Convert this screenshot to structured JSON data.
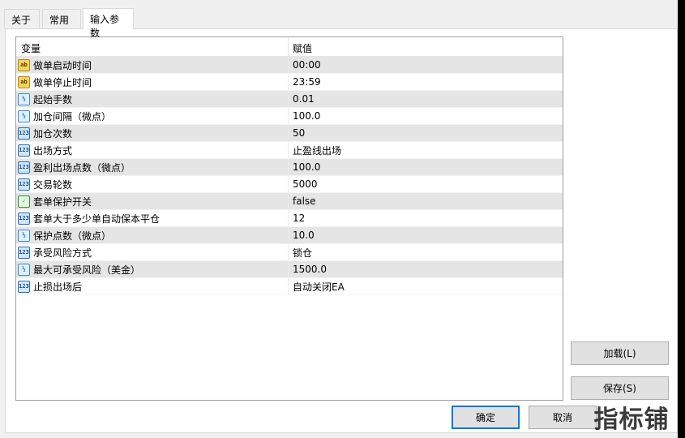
{
  "tabs": [
    {
      "label": "关于"
    },
    {
      "label": "常用"
    },
    {
      "label": "输入参数",
      "active": true
    }
  ],
  "grid": {
    "headers": {
      "variable": "变量",
      "value": "赋值"
    },
    "rows": [
      {
        "icon": "ab",
        "name": "做单启动时间",
        "value": "00:00"
      },
      {
        "icon": "ab",
        "name": "做单停止时间",
        "value": "23:59"
      },
      {
        "icon": "v2",
        "name": "起始手数",
        "value": "0.01"
      },
      {
        "icon": "v2",
        "name": "加仓间隔（微点）",
        "value": "100.0"
      },
      {
        "icon": "123",
        "name": "加仓次数",
        "value": "50"
      },
      {
        "icon": "123",
        "name": "出场方式",
        "value": "止盈线出场"
      },
      {
        "icon": "123",
        "name": "盈利出场点数（微点）",
        "value": "100.0"
      },
      {
        "icon": "123",
        "name": "交易轮数",
        "value": "5000"
      },
      {
        "icon": "bool",
        "name": "套单保护开关",
        "value": "false"
      },
      {
        "icon": "123",
        "name": "套单大于多少单自动保本平仓",
        "value": "12"
      },
      {
        "icon": "v2",
        "name": "保护点数（微点）",
        "value": "10.0"
      },
      {
        "icon": "123",
        "name": "承受风险方式",
        "value": "锁仓"
      },
      {
        "icon": "v2",
        "name": "最大可承受风险（美金）",
        "value": "1500.0"
      },
      {
        "icon": "123",
        "name": "止损出场后",
        "value": "自动关闭EA"
      }
    ]
  },
  "buttons": {
    "load": "加载(L)",
    "save": "保存(S)",
    "ok": "确定",
    "cancel": "取消"
  },
  "watermark": "指标铺"
}
